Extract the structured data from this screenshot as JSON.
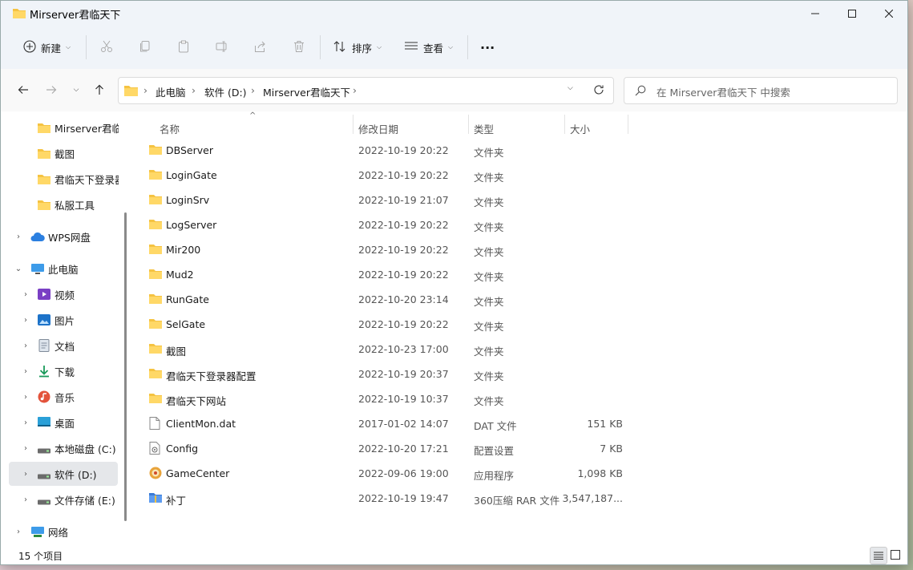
{
  "window": {
    "title": "Mirserver君临天下"
  },
  "toolbar": {
    "new_label": "新建",
    "sort_label": "排序",
    "view_label": "查看",
    "more_label": "···"
  },
  "address": {
    "crumbs": [
      "此电脑",
      "软件 (D:)",
      "Mirserver君临天下"
    ],
    "search_placeholder": "在 Mirserver君临天下 中搜索"
  },
  "sidebar": {
    "pinned": [
      "Mirserver君临天下",
      "截图",
      "君临天下登录器配置",
      "私服工具"
    ],
    "wps": "WPS网盘",
    "this_pc": "此电脑",
    "children": [
      {
        "label": "视频",
        "icon": "video-icon"
      },
      {
        "label": "图片",
        "icon": "pictures-icon"
      },
      {
        "label": "文档",
        "icon": "documents-icon"
      },
      {
        "label": "下载",
        "icon": "download-icon"
      },
      {
        "label": "音乐",
        "icon": "music-icon"
      },
      {
        "label": "桌面",
        "icon": "desktop-icon"
      },
      {
        "label": "本地磁盘 (C:)",
        "icon": "drive-icon"
      },
      {
        "label": "软件 (D:)",
        "icon": "drive-icon"
      },
      {
        "label": "文件存储 (E:)",
        "icon": "drive-icon"
      }
    ],
    "network": "网络"
  },
  "columns": {
    "name": "名称",
    "date": "修改日期",
    "type": "类型",
    "size": "大小"
  },
  "files": [
    {
      "name": "DBServer",
      "date": "2022-10-19 20:22",
      "type": "文件夹",
      "size": "",
      "icon": "folder-icon"
    },
    {
      "name": "LoginGate",
      "date": "2022-10-19 20:22",
      "type": "文件夹",
      "size": "",
      "icon": "folder-icon"
    },
    {
      "name": "LoginSrv",
      "date": "2022-10-19 21:07",
      "type": "文件夹",
      "size": "",
      "icon": "folder-icon"
    },
    {
      "name": "LogServer",
      "date": "2022-10-19 20:22",
      "type": "文件夹",
      "size": "",
      "icon": "folder-icon"
    },
    {
      "name": "Mir200",
      "date": "2022-10-19 20:22",
      "type": "文件夹",
      "size": "",
      "icon": "folder-icon"
    },
    {
      "name": "Mud2",
      "date": "2022-10-19 20:22",
      "type": "文件夹",
      "size": "",
      "icon": "folder-icon"
    },
    {
      "name": "RunGate",
      "date": "2022-10-20 23:14",
      "type": "文件夹",
      "size": "",
      "icon": "folder-icon"
    },
    {
      "name": "SelGate",
      "date": "2022-10-19 20:22",
      "type": "文件夹",
      "size": "",
      "icon": "folder-icon"
    },
    {
      "name": "截图",
      "date": "2022-10-23 17:00",
      "type": "文件夹",
      "size": "",
      "icon": "folder-icon"
    },
    {
      "name": "君临天下登录器配置",
      "date": "2022-10-19 20:37",
      "type": "文件夹",
      "size": "",
      "icon": "folder-icon"
    },
    {
      "name": "君临天下网站",
      "date": "2022-10-19 10:37",
      "type": "文件夹",
      "size": "",
      "icon": "folder-icon"
    },
    {
      "name": "ClientMon.dat",
      "date": "2017-01-02 14:07",
      "type": "DAT 文件",
      "size": "151 KB",
      "icon": "file-icon"
    },
    {
      "name": "Config",
      "date": "2022-10-20 17:21",
      "type": "配置设置",
      "size": "7 KB",
      "icon": "config-icon"
    },
    {
      "name": "GameCenter",
      "date": "2022-09-06 19:00",
      "type": "应用程序",
      "size": "1,098 KB",
      "icon": "app-icon"
    },
    {
      "name": "补丁",
      "date": "2022-10-19 19:47",
      "type": "360压缩 RAR 文件",
      "size": "3,547,187...",
      "icon": "archive-icon"
    }
  ],
  "status": {
    "count": "15 个项目"
  },
  "colors": {
    "folder": "#f5c342",
    "accent": "#0067c0",
    "selection": "#e5e7ea"
  }
}
